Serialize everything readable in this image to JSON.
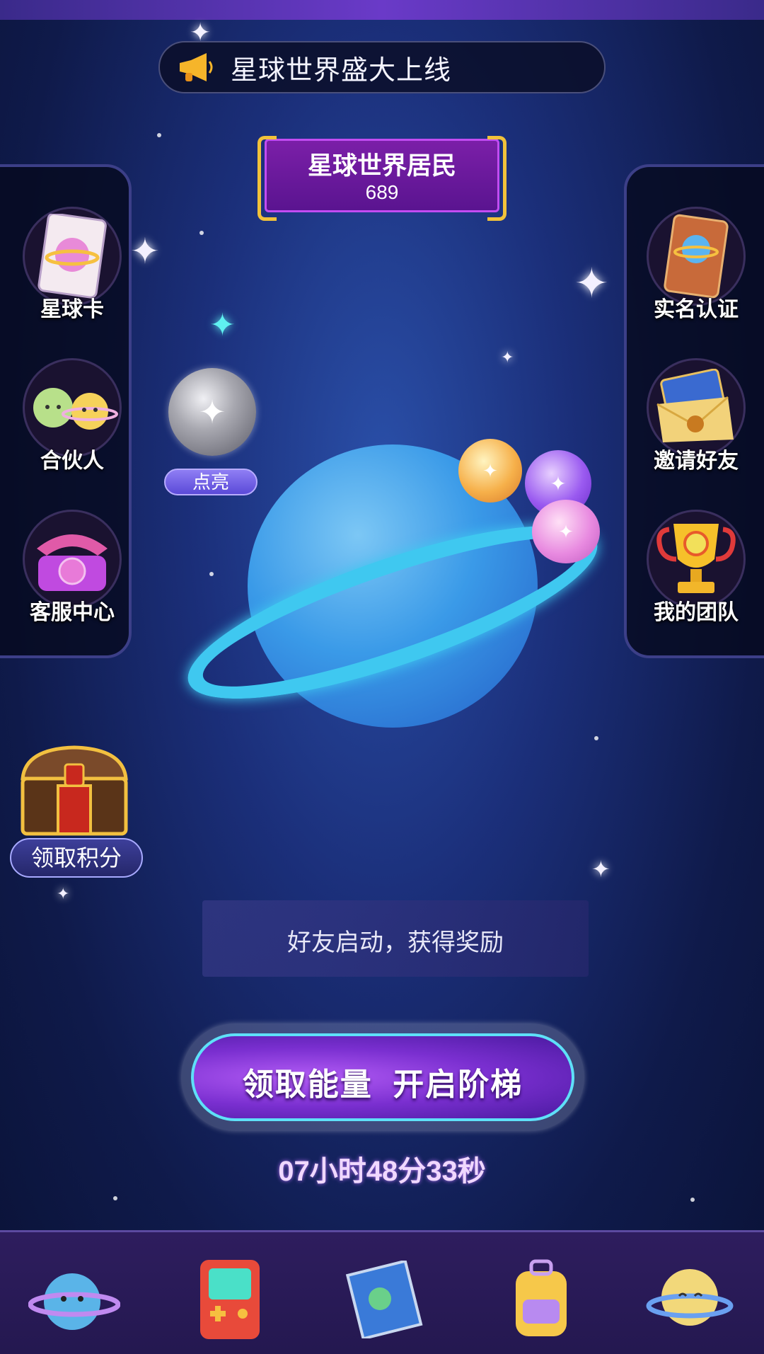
{
  "announcement": {
    "text": "星球世界盛大上线",
    "icon": "megaphone-icon"
  },
  "title_plaque": {
    "title": "星球世界居民",
    "count": "689"
  },
  "left_menu": [
    {
      "label": "星球卡",
      "icon": "planet-card-icon"
    },
    {
      "label": "合伙人",
      "icon": "partner-planets-icon"
    },
    {
      "label": "客服中心",
      "icon": "telephone-icon"
    }
  ],
  "right_menu": [
    {
      "label": "实名认证",
      "icon": "id-card-icon"
    },
    {
      "label": "邀请好友",
      "icon": "envelope-icon"
    },
    {
      "label": "我的团队",
      "icon": "trophy-icon"
    }
  ],
  "light_up": {
    "label": "点亮"
  },
  "claim_points": {
    "label": "领取积分",
    "icon": "treasure-chest-icon"
  },
  "reward_message": "好友启动，获得奖励",
  "main_button": {
    "label": "领取能量  开启阶梯"
  },
  "countdown": "07小时48分33秒",
  "bottom_nav": [
    {
      "icon": "planet-home-icon"
    },
    {
      "icon": "game-console-icon"
    },
    {
      "icon": "map-scroll-icon"
    },
    {
      "icon": "backpack-icon"
    },
    {
      "icon": "moon-planet-icon"
    }
  ],
  "colors": {
    "accent_purple": "#7b1fa8",
    "ring_cyan": "#3fc8f0",
    "gold": "#f2c23a"
  }
}
